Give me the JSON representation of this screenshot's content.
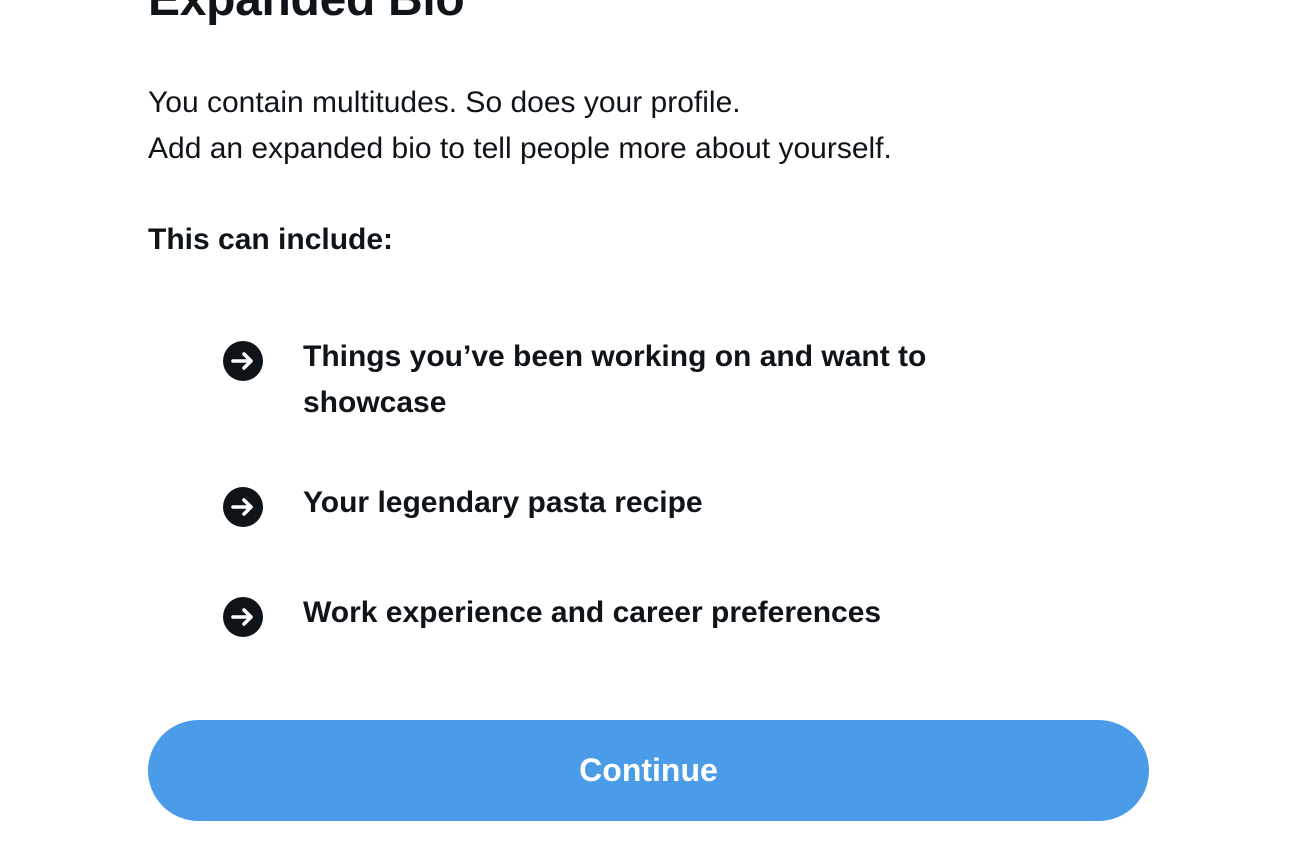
{
  "title": "Expanded Bio",
  "description": {
    "line1": "You contain multitudes. So does your profile.",
    "line2": "Add an expanded bio to tell people more about yourself."
  },
  "includes_heading": "This can include:",
  "features": [
    {
      "icon": "arrow-right-circle-icon",
      "text": "Things you’ve been working on and want to showcase"
    },
    {
      "icon": "arrow-right-circle-icon",
      "text": "Your legendary pasta recipe"
    },
    {
      "icon": "arrow-right-circle-icon",
      "text": "Work experience and career preferences"
    }
  ],
  "continue_label": "Continue",
  "colors": {
    "button_background": "#4a9be8",
    "button_text": "#ffffff",
    "text": "#0f1419",
    "icon": "#0f1419"
  }
}
